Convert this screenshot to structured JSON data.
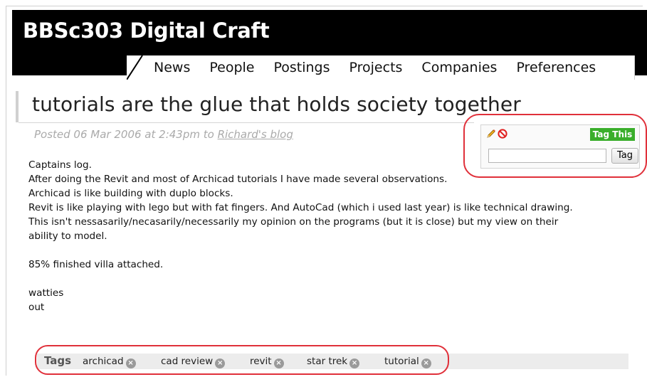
{
  "site": {
    "title": "BBSc303 Digital Craft"
  },
  "nav": [
    "News",
    "People",
    "Postings",
    "Projects",
    "Companies",
    "Preferences"
  ],
  "post": {
    "title": "tutorials are the glue that holds society together",
    "meta_prefix": "Posted 06 Mar 2006 at 2:43pm to ",
    "meta_link": "Richard's blog",
    "body": [
      "Captains log.",
      "After doing the Revit and most of Archicad tutorials I have made several observations.",
      "Archicad is like building with duplo blocks.",
      "Revit is like playing with lego but with fat fingers. And AutoCad (which i used last year) is like technical drawing.",
      "This isn't nessasarily/necasarily/necessarily my opinion on the programs (but it is close) but my view on their",
      "ability to model.",
      "",
      "85% finished villa attached.",
      "",
      "watties",
      "out"
    ]
  },
  "tagging": {
    "tag_this_label": "Tag This",
    "input_value": "",
    "tag_button_label": "Tag",
    "edit_icon": "pencil-icon",
    "delete_icon": "no-entry-icon"
  },
  "tags": {
    "label": "Tags",
    "items": [
      "archicad",
      "cad review",
      "revit",
      "star trek",
      "tutorial"
    ],
    "remove_symbol": "×"
  },
  "colors": {
    "header_bg": "#000000",
    "tag_this_bg": "#3aae2b",
    "highlight": "#e0303a",
    "meta_text": "#aaaaaa"
  }
}
